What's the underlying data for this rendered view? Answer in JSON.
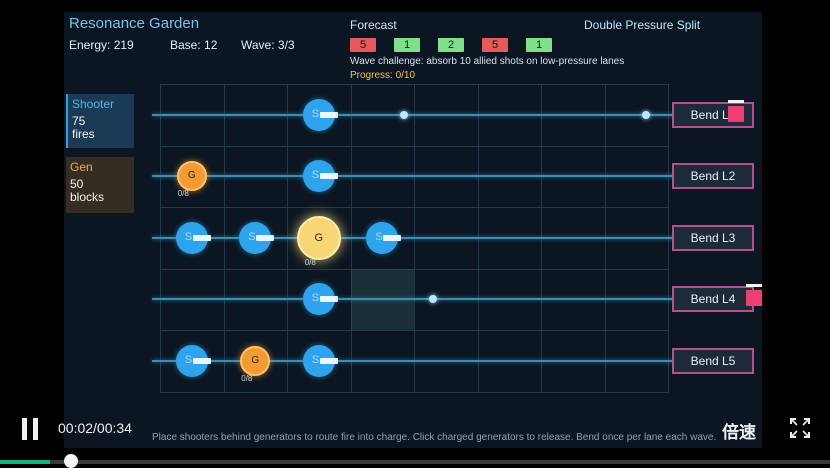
{
  "hud": {
    "title": "Resonance Garden",
    "energy": "Energy: 219",
    "base": "Base: 12",
    "wave": "Wave: 3/3",
    "forecast_label": "Forecast",
    "mode": "Double Pressure Split",
    "forecast": [
      {
        "value": "5",
        "kind": "hot"
      },
      {
        "value": "1",
        "kind": "cool"
      },
      {
        "value": "2",
        "kind": "cool"
      },
      {
        "value": "5",
        "kind": "hot"
      },
      {
        "value": "1",
        "kind": "cool"
      }
    ],
    "challenge": "Wave challenge: absorb 10 allied shots on low-pressure lanes",
    "progress": "Progress: 0/10"
  },
  "palette": {
    "shooter": {
      "title": "Shooter",
      "cost": "75",
      "unit": "fires"
    },
    "gen": {
      "title": "Gen",
      "cost": "50",
      "unit": "blocks"
    }
  },
  "board": {
    "rows": 5,
    "cols": 8,
    "highlight": {
      "row": 3,
      "col": 3
    },
    "shooter_label": "S",
    "gen_label": "G",
    "shooters": [
      {
        "row": 0,
        "col": 2
      },
      {
        "row": 1,
        "col": 2
      },
      {
        "row": 2,
        "col": 0
      },
      {
        "row": 2,
        "col": 1
      },
      {
        "row": 2,
        "col": 3
      },
      {
        "row": 3,
        "col": 2
      },
      {
        "row": 4,
        "col": 0
      },
      {
        "row": 4,
        "col": 2
      }
    ],
    "generators": [
      {
        "row": 1,
        "col": 0,
        "size": "small",
        "count": "0/8"
      },
      {
        "row": 2,
        "col": 2,
        "size": "big",
        "count": "0/8"
      },
      {
        "row": 4,
        "col": 1,
        "size": "small",
        "count": "0/8"
      }
    ],
    "shots": [
      {
        "row": 0,
        "col": 3.85
      },
      {
        "row": 0,
        "col": 7.65
      },
      {
        "row": 3,
        "col": 4.3
      }
    ],
    "bends": [
      {
        "label": "Bend L1",
        "marked": true
      },
      {
        "label": "Bend L2",
        "marked": false
      },
      {
        "label": "Bend L3",
        "marked": false
      },
      {
        "label": "Bend L4",
        "marked": true
      },
      {
        "label": "Bend L5",
        "marked": false
      }
    ]
  },
  "help_text": "Place shooters behind generators to route fire into charge. Click charged generators to release. Bend once per lane each wave.",
  "player": {
    "time": "00:02/00:34",
    "speed_label": "倍速",
    "progress_fraction": 0.06,
    "accent": "#14b07a"
  }
}
